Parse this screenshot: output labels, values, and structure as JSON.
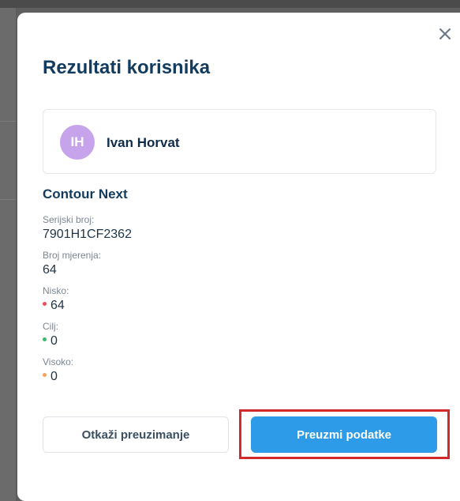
{
  "modal": {
    "title": "Rezultati korisnika",
    "close_icon": "×"
  },
  "user": {
    "initials": "IH",
    "name": "Ivan Horvat",
    "avatar_color": "#c6a3ea"
  },
  "device": {
    "name": "Contour Next",
    "fields": [
      {
        "label": "Serijski broj:",
        "value": "7901H1CF2362"
      },
      {
        "label": "Broj mjerenja:",
        "value": "64"
      },
      {
        "label": "Nisko:",
        "value": "64",
        "dot_color": "#e8505b"
      },
      {
        "label": "Cilj:",
        "value": "0",
        "dot_color": "#3fb772"
      },
      {
        "label": "Visoko:",
        "value": "0",
        "dot_color": "#f2a35e"
      }
    ]
  },
  "actions": {
    "cancel_label": "Otkaži preuzimanje",
    "download_label": "Preuzmi podatke",
    "primary_color": "#2d9be8",
    "highlight_color": "#d22a2a"
  }
}
